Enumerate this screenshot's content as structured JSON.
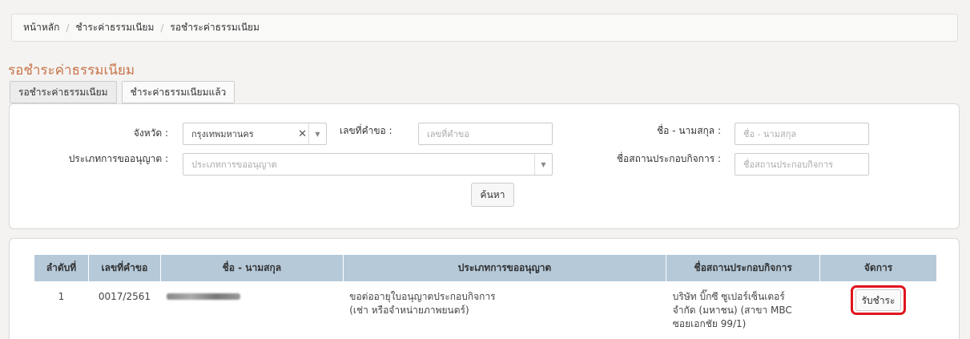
{
  "breadcrumb": {
    "home": "หน้าหลัก",
    "section": "ชำระค่าธรรมเนียม",
    "current": "รอชำระค่าธรรมเนียม"
  },
  "page_title": "รอชำระค่าธรรมเนียม",
  "tabs": [
    {
      "label": "รอชำระค่าธรรมเนียม",
      "active": true
    },
    {
      "label": "ชำระค่าธรรมเนียมแล้ว",
      "active": false
    }
  ],
  "search": {
    "province_label": "จังหวัด :",
    "province_value": "กรุงเทพมหานคร",
    "request_no_label": "เลขที่คำขอ :",
    "request_no_placeholder": "เลขที่คำขอ",
    "name_label": "ชื่อ - นามสกุล :",
    "name_placeholder": "ชื่อ - นามสกุล",
    "license_type_label": "ประเภทการขออนุญาต :",
    "license_type_placeholder": "ประเภทการขออนุญาต",
    "business_label": "ชื่อสถานประกอบกิจการ :",
    "business_placeholder": "ชื่อสถานประกอบกิจการ",
    "search_button": "ค้นหา"
  },
  "table": {
    "headers": [
      "ลำดับที่",
      "เลขที่คำขอ",
      "ชื่อ - นามสกุล",
      "ประเภทการขออนุญาต",
      "ชื่อสถานประกอบกิจการ",
      "จัดการ"
    ],
    "rows": [
      {
        "index": "1",
        "request_no": "0017/2561",
        "license_type_line1": "ขอต่ออายุใบอนุญาตประกอบกิจการ",
        "license_type_line2": "(เช่า หรือจำหน่ายภาพยนตร์)",
        "business_line1": "บริษัท บิ๊กซี ซูเปอร์เซ็นเตอร์",
        "business_line2": "จำกัด (มหาชน) (สาขา MBC",
        "business_line3": "ซอยเอกชัย 99/1)",
        "action": "รับชำระ"
      }
    ]
  },
  "colors": {
    "title": "#c8744a",
    "table_header": "#b5c9d9",
    "highlight": "#e0141d"
  }
}
